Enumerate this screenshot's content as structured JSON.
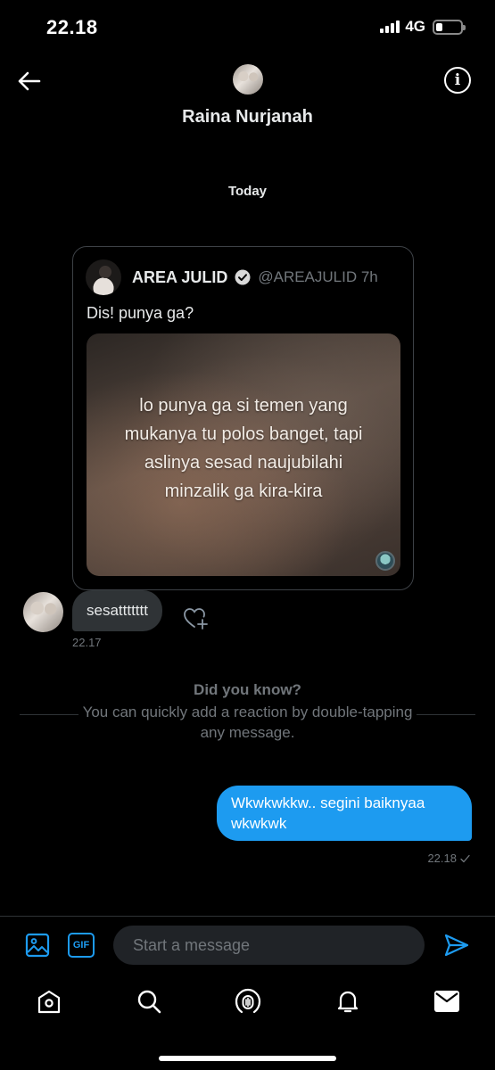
{
  "status_bar": {
    "time": "22.18",
    "network": "4G",
    "battery_level": 0.25
  },
  "header": {
    "contact_name": "Raina Nurjanah"
  },
  "conversation": {
    "date_separator": "Today",
    "shared_tweet": {
      "author_name": "AREA JULID",
      "handle_and_time": "@AREAJULID 7h",
      "text": "Dis! punya ga?",
      "media_caption": "lo punya ga si temen yang mukanya tu polos banget, tapi aslinya sesad naujubilahi minzalik ga kira-kira"
    },
    "received_message": {
      "text": "sesattttttt",
      "time": "22.17"
    },
    "tip": {
      "title": "Did you know?",
      "body": "You can quickly add a reaction by double-tapping any message."
    },
    "sent_message": {
      "text": "Wkwkwkkw.. segini baiknyaa wkwkwk",
      "time": "22.18",
      "status_icon": "checkmark-icon"
    }
  },
  "composer": {
    "gif_label": "GIF",
    "placeholder": "Start a message"
  },
  "colors": {
    "accent": "#1d9bf0",
    "background": "#000000",
    "bubble_received": "#2f3336",
    "muted_text": "#71767b"
  },
  "bottom_nav": [
    "home-icon",
    "search-icon",
    "spaces-icon",
    "notifications-icon",
    "messages-icon"
  ]
}
